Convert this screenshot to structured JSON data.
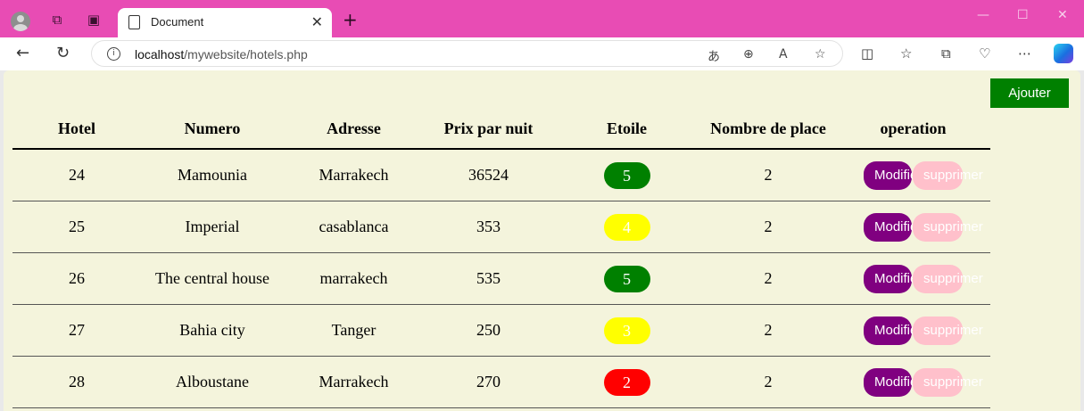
{
  "browser": {
    "tab_title": "Document",
    "close_glyph": "✕",
    "new_tab_glyph": "+",
    "url_host": "localhost",
    "url_path": "/mywebsite/hotels.php"
  },
  "page": {
    "add_button": "Ajouter",
    "columns": [
      "Hotel",
      "Numero",
      "Adresse",
      "Prix par nuit",
      "Etoile",
      "Nombre de place",
      "operation"
    ],
    "rows": [
      {
        "hotel": "24",
        "numero": "Mamounia",
        "adresse": "Marrakech",
        "prix": "36524",
        "etoile": "5",
        "etoile_color": "#008000",
        "places": "2"
      },
      {
        "hotel": "25",
        "numero": "Imperial",
        "adresse": "casablanca",
        "prix": "353",
        "etoile": "4",
        "etoile_color": "#ffff00",
        "places": "2"
      },
      {
        "hotel": "26",
        "numero": "The central house",
        "adresse": "marrakech",
        "prix": "535",
        "etoile": "5",
        "etoile_color": "#008000",
        "places": "2"
      },
      {
        "hotel": "27",
        "numero": "Bahia city",
        "adresse": "Tanger",
        "prix": "250",
        "etoile": "3",
        "etoile_color": "#ffff00",
        "places": "2"
      },
      {
        "hotel": "28",
        "numero": "Alboustane",
        "adresse": "Marrakech",
        "prix": "270",
        "etoile": "2",
        "etoile_color": "#ff0000",
        "places": "2"
      }
    ],
    "modify_label": "Modifier",
    "delete_label": "supprimer"
  }
}
